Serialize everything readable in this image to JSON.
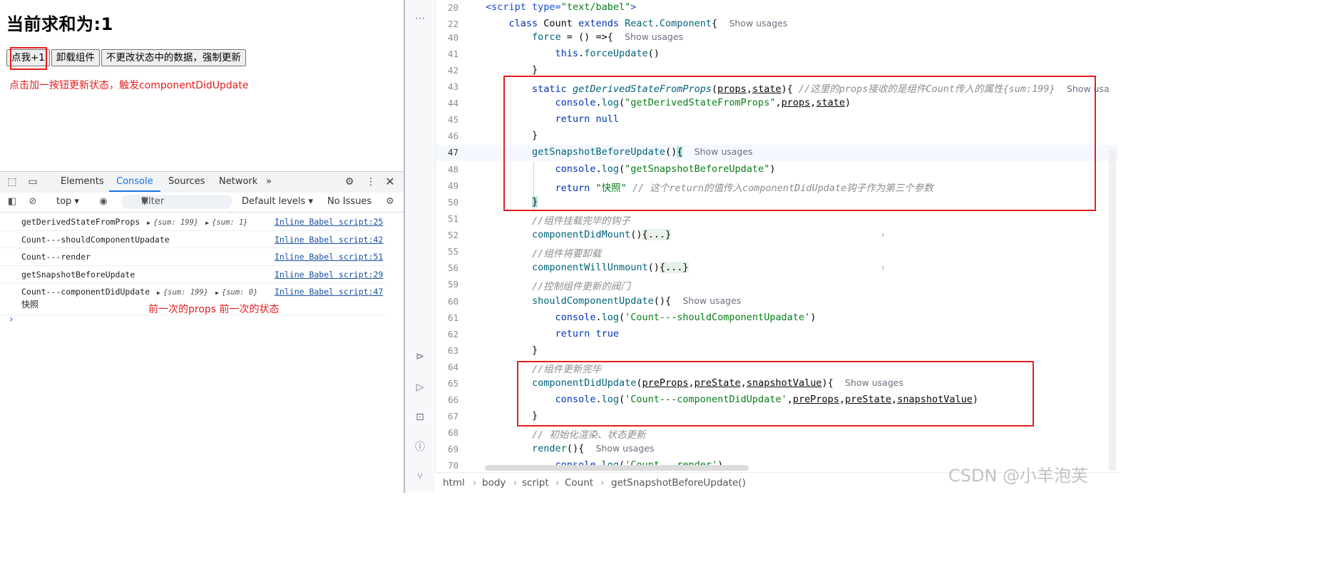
{
  "page": {
    "title": "当前求和为:1",
    "buttons": [
      "点我+1",
      "卸载组件",
      "不更改状态中的数据，强制更新"
    ],
    "note_update": "点击加一按钮更新状态，触发componentDidUpdate"
  },
  "devtools": {
    "tabs": [
      "Elements",
      "Console",
      "Sources",
      "Network"
    ],
    "active_tab": "Console",
    "more_tabs": "»",
    "context": "top ▾",
    "filter_placeholder": "Filter",
    "levels": "Default levels ▾",
    "issues": "No Issues",
    "logs": [
      {
        "msg": "getDerivedStateFromProps",
        "obj1": "{sum: 199}",
        "obj2": "{sum: 1}",
        "src": "Inline Babel script:25"
      },
      {
        "msg": "Count---shouldComponentUpadate",
        "src": "Inline Babel script:42"
      },
      {
        "msg": "Count---render",
        "src": "Inline Babel script:51"
      },
      {
        "msg": "getSnapshotBeforeUpdate",
        "src": "Inline Babel script:29"
      },
      {
        "msg": "Count---componentDidUpdate",
        "obj1": "{sum: 199}",
        "obj2": "{sum: 0}",
        "line2": "快照",
        "src": "Inline Babel script:47"
      }
    ],
    "note_prev": "前一次的props    前一次的状态",
    "prompt": "›"
  },
  "editor": {
    "line_numbers": [
      "20",
      "22",
      "40",
      "41",
      "42",
      "43",
      "44",
      "45",
      "46",
      "47",
      "48",
      "49",
      "50",
      "51",
      "52",
      "55",
      "56",
      "59",
      "60",
      "61",
      "62",
      "63",
      "64",
      "65",
      "66",
      "67",
      "68",
      "69",
      "70"
    ],
    "show_usages": "Show usages",
    "show_usa_cut": "Show usa",
    "lines": {
      "l20_tag": "<script",
      "l20_attr": " type=",
      "l20_val": "\"text/babel\"",
      "l20_end": ">",
      "l22_a": "class",
      "l22_b": " Count ",
      "l22_c": "extends",
      "l22_d": " React.",
      "l22_e": "Component",
      "l22_f": "{",
      "l40_a": "force",
      "l40_b": " = () =>{",
      "l41_a": "this",
      "l41_b": ".",
      "l41_c": "forceUpdate",
      "l41_d": "()",
      "l42": "}",
      "l43_a": "static",
      "l43_b": "getDerivedStateFromProps",
      "l43_c": "(",
      "l43_d": "props",
      "l43_e": ",",
      "l43_f": "state",
      "l43_g": "){ ",
      "l43_cm": "//这里的props接收的是组件Count传入的属性{sum:199}",
      "l44_a": "console",
      "l44_b": ".",
      "l44_c": "log",
      "l44_d": "(",
      "l44_e": "\"getDerivedStateFromProps\"",
      "l44_f": ",",
      "l44_g": "props",
      "l44_h": ",",
      "l44_i": "state",
      "l44_j": ")",
      "l45_a": "return",
      "l45_b": " null",
      "l46": "}",
      "l47_a": "getSnapshotBeforeUpdate",
      "l47_b": "()",
      "l47_c": "{",
      "l48_a": "console",
      "l48_b": ".",
      "l48_c": "log",
      "l48_d": "(",
      "l48_e": "\"getSnapshotBeforeUpdate\"",
      "l48_f": ")",
      "l49_a": "return",
      "l49_b": " \"快照\"",
      "l49_cm": " // 这个return的值传入componentDidUpdate钩子作为第三个参数",
      "l50": "}",
      "l51_cm": "//组件挂载完毕的钩子",
      "l52_a": "componentDidMount",
      "l52_b": "()",
      "l52_c": "{...}",
      "l55_cm": "//组件将要卸载",
      "l56_a": "componentWillUnmount",
      "l56_b": "()",
      "l56_c": "{...}",
      "l59_cm": "//控制组件更新的阀门",
      "l60_a": "shouldComponentUpdate",
      "l60_b": "(){",
      "l61_a": "console",
      "l61_b": ".",
      "l61_c": "log",
      "l61_d": "(",
      "l61_e": "'Count---shouldComponentUpadate'",
      "l61_f": ")",
      "l62_a": "return",
      "l62_b": " true",
      "l63": "}",
      "l64_cm": "//组件更新完毕",
      "l65_a": "componentDidUpdate",
      "l65_b": "(",
      "l65_c": "preProps",
      "l65_d": ",",
      "l65_e": "preState",
      "l65_f": ",",
      "l65_g": "snapshotValue",
      "l65_h": "){",
      "l66_a": "console",
      "l66_b": ".",
      "l66_c": "log",
      "l66_d": "(",
      "l66_e": "'Count---componentDidUpdate'",
      "l66_f": ",",
      "l66_g": "preProps",
      "l66_h": ",",
      "l66_i": "preState",
      "l66_j": ",",
      "l66_k": "snapshotValue",
      "l66_l": ")",
      "l67": "}",
      "l68_cm": "// 初始化渲染、状态更新",
      "l69_a": "render",
      "l69_b": "(){",
      "l70_a": "console",
      "l70_b": ".",
      "l70_c": "log",
      "l70_d": "(",
      "l70_e": "'Count---render'",
      "l70_f": ")"
    },
    "breadcrumb": [
      "html",
      "body",
      "script",
      "Count",
      "getSnapshotBeforeUpdate()"
    ],
    "breadcrumb_sep": "›"
  },
  "watermark": "CSDN @小羊泡芙",
  "colors": {
    "annotation_red": "#e61e1e",
    "devtools_active": "#1a73e8",
    "keyword": "#0033b3",
    "string": "#067d17",
    "function": "#00627a"
  }
}
